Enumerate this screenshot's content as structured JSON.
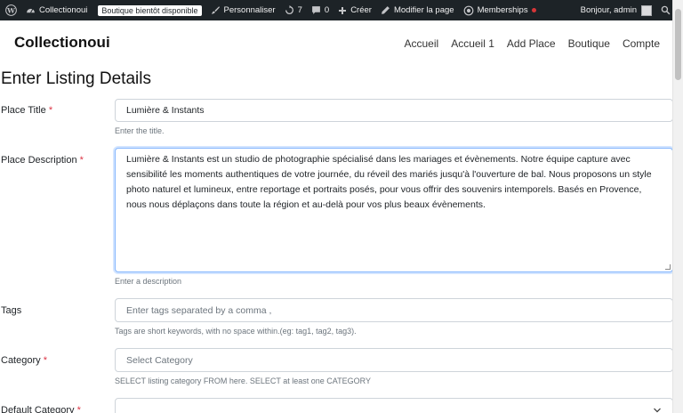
{
  "adminbar": {
    "site_name": "Collectionoui",
    "badge": "Boutique bientôt disponible",
    "customize": "Personnaliser",
    "updates_count": "7",
    "comments_count": "0",
    "create": "Créer",
    "edit_page": "Modifier la page",
    "memberships": "Memberships",
    "greeting": "Bonjour, admin"
  },
  "header": {
    "site_title": "Collectionoui",
    "nav": [
      "Accueil",
      "Accueil 1",
      "Add Place",
      "Boutique",
      "Compte"
    ]
  },
  "form": {
    "heading": "Enter Listing Details",
    "title_label": "Place Title",
    "title_value": "Lumière & Instants",
    "title_help": "Enter the title.",
    "description_label": "Place Description",
    "description_value": "Lumière & Instants est un studio de photographie spécialisé dans les mariages et évènements. Notre équipe capture avec sensibilité les moments authentiques de votre journée, du réveil des mariés jusqu'à l'ouverture de bal. Nous proposons un style photo naturel et lumineux, entre reportage et portraits posés, pour vous offrir des souvenirs intemporels. Basés en Provence, nous nous déplaçons dans toute la région et au-delà pour vos plus beaux évènements.",
    "description_help": "Enter a description",
    "tags_label": "Tags",
    "tags_placeholder": "Enter tags separated by a comma ,",
    "tags_help": "Tags are short keywords, with no space within.(eg: tag1, tag2, tag3).",
    "category_label": "Category",
    "category_placeholder": "Select Category",
    "category_help": "SELECT listing category FROM here. SELECT at least one CATEGORY",
    "default_category_label": "Default Category",
    "required_mark": "*"
  },
  "icons": {
    "wordpress": "wordpress-logo-icon",
    "home": "dashboard-icon",
    "customize": "brush-icon",
    "updates": "refresh-icon",
    "comments": "comment-icon",
    "create": "plus-icon",
    "edit": "pencil-icon",
    "memberships": "memberships-icon",
    "search": "search-icon"
  },
  "colors": {
    "adminbar_bg": "#1d2327",
    "required": "#dc3545",
    "focus_border": "#86b7fe",
    "notification_dot": "#d63638"
  }
}
